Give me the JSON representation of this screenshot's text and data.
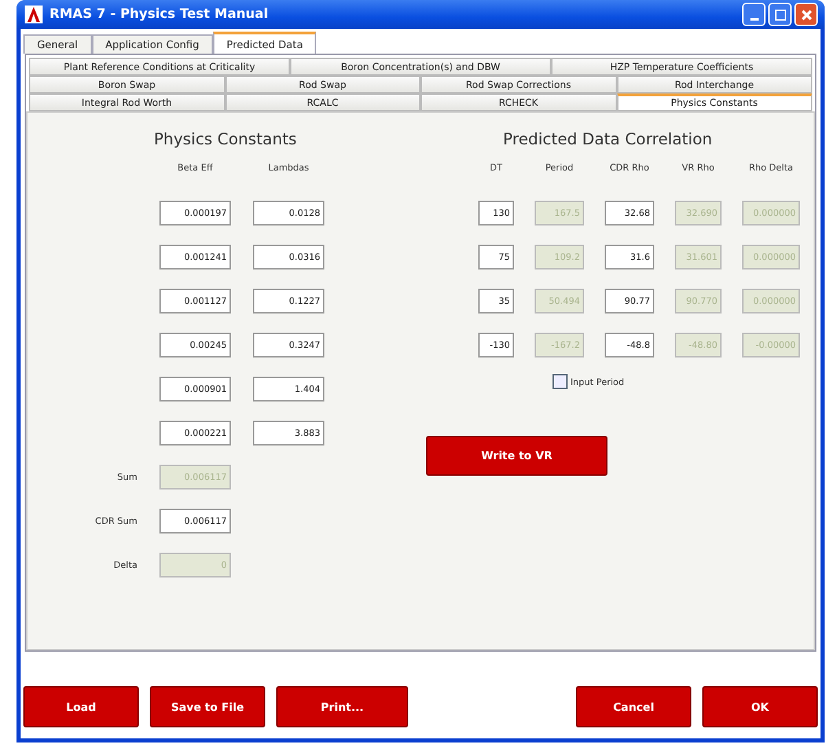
{
  "window": {
    "title": "RMAS 7 - Physics Test Manual"
  },
  "main_tabs": [
    {
      "label": "General",
      "selected": false
    },
    {
      "label": "Application Config",
      "selected": false
    },
    {
      "label": "Predicted Data",
      "selected": true
    }
  ],
  "sub_tabs": [
    [
      {
        "label": "Plant Reference Conditions at Criticality",
        "selected": false
      },
      {
        "label": "Boron Concentration(s) and DBW",
        "selected": false
      },
      {
        "label": "HZP Temperature Coefficients",
        "selected": false
      }
    ],
    [
      {
        "label": "Boron Swap",
        "selected": false
      },
      {
        "label": "Rod Swap",
        "selected": false
      },
      {
        "label": "Rod Swap Corrections",
        "selected": false
      },
      {
        "label": "Rod Interchange",
        "selected": false
      }
    ],
    [
      {
        "label": "Integral Rod Worth",
        "selected": false
      },
      {
        "label": "RCALC",
        "selected": false
      },
      {
        "label": "RCHECK",
        "selected": false
      },
      {
        "label": "Physics Constants",
        "selected": true
      }
    ]
  ],
  "physics_constants": {
    "title": "Physics Constants",
    "columns": [
      {
        "label": "Beta Eff",
        "disabled": false
      },
      {
        "label": "Lambdas",
        "disabled": false
      }
    ],
    "rows": [
      [
        "0.000197",
        "0.0128"
      ],
      [
        "0.001241",
        "0.0316"
      ],
      [
        "0.001127",
        "0.1227"
      ],
      [
        "0.00245",
        "0.3247"
      ],
      [
        "0.000901",
        "1.404"
      ],
      [
        "0.000221",
        "3.883"
      ]
    ],
    "summary": [
      {
        "label": "Sum",
        "value": "0.006117",
        "disabled": true
      },
      {
        "label": "CDR Sum",
        "value": "0.006117",
        "disabled": false
      },
      {
        "label": "Delta",
        "value": "0",
        "disabled": true
      }
    ]
  },
  "correlation": {
    "title": "Predicted Data Correlation",
    "columns": [
      {
        "label": "DT",
        "disabled": false
      },
      {
        "label": "Period",
        "disabled": true
      },
      {
        "label": "CDR Rho",
        "disabled": false
      },
      {
        "label": "VR Rho",
        "disabled": true
      },
      {
        "label": "Rho Delta",
        "disabled": true
      }
    ],
    "rows": [
      [
        "130",
        "167.5",
        "32.68",
        "32.690",
        "0.000000"
      ],
      [
        "75",
        "109.2",
        "31.6",
        "31.601",
        "0.000000"
      ],
      [
        "35",
        "50.494",
        "90.77",
        "90.770",
        "0.000000"
      ],
      [
        "-130",
        "-167.2",
        "-48.8",
        "-48.80",
        "-0.00000"
      ]
    ],
    "input_period": {
      "label": "Input Period",
      "checked": false
    },
    "write_button": "Write to VR"
  },
  "buttons_left": [
    "Load",
    "Save to File",
    "Print..."
  ],
  "buttons_right": [
    "Cancel",
    "OK"
  ]
}
